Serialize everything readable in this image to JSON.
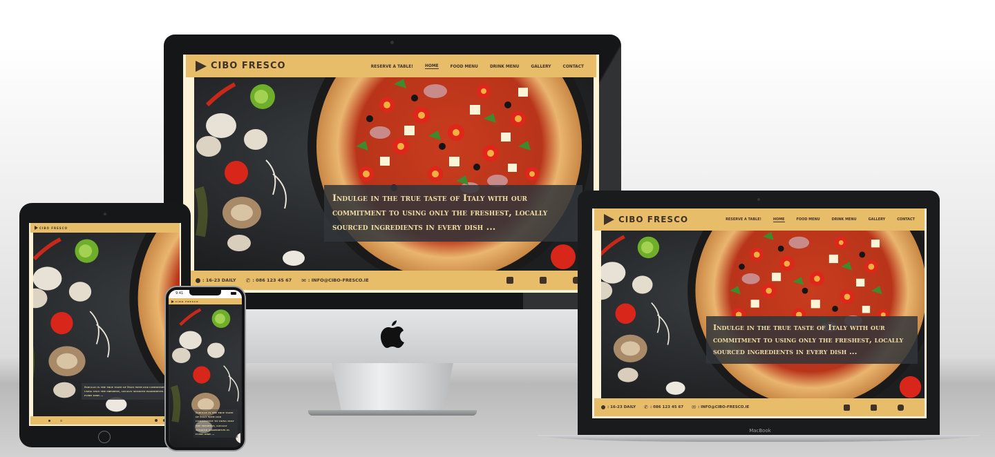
{
  "site": {
    "brand": "CIBO FRESCO",
    "nav": [
      "RESERVE A TABLE!",
      "HOME",
      "FOOD MENU",
      "DRINK MENU",
      "GALLERY",
      "CONTACT"
    ],
    "active_nav": "HOME",
    "tagline": "Indulge in the true taste of Italy with our commitment to using only the freshest, locally sourced ingredients in every dish ...",
    "footer": {
      "hours": ": 16-23 DAILY",
      "phone": ": 086 123 45 67",
      "email": ": INFO@CIBO-FRESCO.IE"
    },
    "social_icons": [
      "facebook-icon",
      "twitter-icon",
      "instagram-icon"
    ]
  },
  "devices": {
    "laptop_label": "MacBook",
    "phone_time": "9:41"
  },
  "colors": {
    "nav": "#e8bd6a",
    "nav_text": "#3f3329",
    "cream": "#fbf2d8",
    "tagline_text": "#f0dca4",
    "tagline_bg": "#32363a"
  }
}
